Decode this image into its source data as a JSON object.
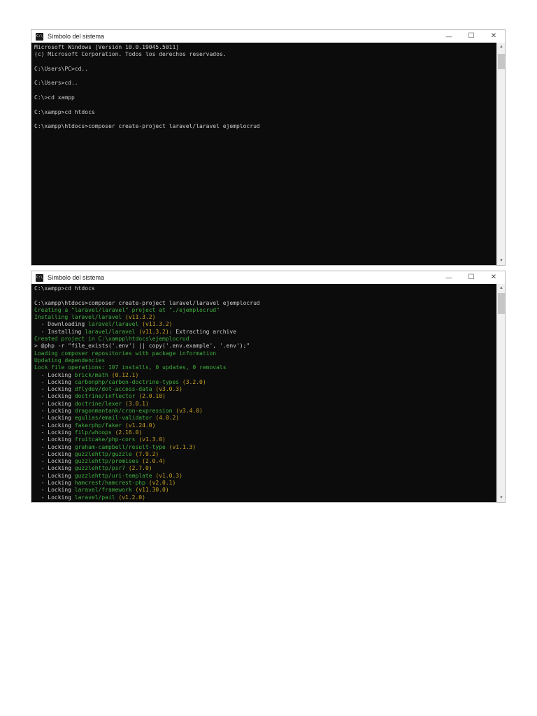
{
  "colors": {
    "d": "#cccccc",
    "g": "#3fae3f",
    "y": "#c9a227"
  },
  "chrome": {
    "cmd_icon_text": "C:\\",
    "minimize_glyph": "—",
    "maximize_glyph": "☐",
    "close_glyph": "✕",
    "scroll_up_glyph": "▲",
    "scroll_down_glyph": "▼"
  },
  "window1": {
    "title": "Símbolo del sistema",
    "lines": [
      [
        [
          "d",
          "Microsoft Windows [Versión 10.0.19045.5011]"
        ]
      ],
      [
        [
          "d",
          "(c) Microsoft Corporation. Todos los derechos reservados."
        ]
      ],
      [],
      [
        [
          "d",
          "C:\\Users\\PC>cd.."
        ]
      ],
      [],
      [
        [
          "d",
          "C:\\Users>cd.."
        ]
      ],
      [],
      [
        [
          "d",
          "C:\\>cd xampp"
        ]
      ],
      [],
      [
        [
          "d",
          "C:\\xampp>cd htdocs"
        ]
      ],
      [],
      [
        [
          "d",
          "C:\\xampp\\htdocs>composer create-project laravel/laravel ejemplocrud"
        ]
      ]
    ]
  },
  "window2": {
    "title": "Símbolo del sistema",
    "lines": [
      [
        [
          "d",
          "C:\\xampp>cd htdocs"
        ]
      ],
      [],
      [
        [
          "d",
          "C:\\xampp\\htdocs>composer create-project laravel/laravel ejemplocrud"
        ]
      ],
      [
        [
          "g",
          "Creating a \"laravel/laravel\" project at \"./ejemplocrud\""
        ]
      ],
      [
        [
          "g",
          "Installing laravel/laravel "
        ],
        [
          "y",
          "(v11.3.2)"
        ]
      ],
      [
        [
          "d",
          "  - Downloading "
        ],
        [
          "g",
          "laravel/laravel"
        ],
        [
          "y",
          " (v11.3.2)"
        ]
      ],
      [
        [
          "d",
          "  - Installing "
        ],
        [
          "g",
          "laravel/laravel"
        ],
        [
          "y",
          " (v11.3.2)"
        ],
        [
          "d",
          ": Extracting archive"
        ]
      ],
      [
        [
          "g",
          "Created project in C:\\xampp\\htdocs\\ejemplocrud"
        ]
      ],
      [
        [
          "d",
          "> @php -r \"file_exists('.env') || copy('.env.example', '.env');\""
        ]
      ],
      [
        [
          "g",
          "Loading composer repositories with package information"
        ]
      ],
      [
        [
          "g",
          "Updating dependencies"
        ]
      ],
      [
        [
          "g",
          "Lock file operations: 107 installs, 0 updates, 0 removals"
        ]
      ],
      [
        [
          "d",
          "  - Locking "
        ],
        [
          "g",
          "brick/math"
        ],
        [
          "y",
          " (0.12.1)"
        ]
      ],
      [
        [
          "d",
          "  - Locking "
        ],
        [
          "g",
          "carbonphp/carbon-doctrine-types"
        ],
        [
          "y",
          " (3.2.0)"
        ]
      ],
      [
        [
          "d",
          "  - Locking "
        ],
        [
          "g",
          "dflydev/dot-access-data"
        ],
        [
          "y",
          " (v3.0.3)"
        ]
      ],
      [
        [
          "d",
          "  - Locking "
        ],
        [
          "g",
          "doctrine/inflector"
        ],
        [
          "y",
          " (2.0.10)"
        ]
      ],
      [
        [
          "d",
          "  - Locking "
        ],
        [
          "g",
          "doctrine/lexer"
        ],
        [
          "y",
          " (3.0.1)"
        ]
      ],
      [
        [
          "d",
          "  - Locking "
        ],
        [
          "g",
          "dragonmantank/cron-expression"
        ],
        [
          "y",
          " (v3.4.0)"
        ]
      ],
      [
        [
          "d",
          "  - Locking "
        ],
        [
          "g",
          "egulias/email-validator"
        ],
        [
          "y",
          " (4.0.2)"
        ]
      ],
      [
        [
          "d",
          "  - Locking "
        ],
        [
          "g",
          "fakerphp/faker"
        ],
        [
          "y",
          " (v1.24.0)"
        ]
      ],
      [
        [
          "d",
          "  - Locking "
        ],
        [
          "g",
          "filp/whoops"
        ],
        [
          "y",
          " (2.16.0)"
        ]
      ],
      [
        [
          "d",
          "  - Locking "
        ],
        [
          "g",
          "fruitcake/php-cors"
        ],
        [
          "y",
          " (v1.3.0)"
        ]
      ],
      [
        [
          "d",
          "  - Locking "
        ],
        [
          "g",
          "graham-campbell/result-type"
        ],
        [
          "y",
          " (v1.1.3)"
        ]
      ],
      [
        [
          "d",
          "  - Locking "
        ],
        [
          "g",
          "guzzlehttp/guzzle"
        ],
        [
          "y",
          " (7.9.2)"
        ]
      ],
      [
        [
          "d",
          "  - Locking "
        ],
        [
          "g",
          "guzzlehttp/promises"
        ],
        [
          "y",
          " (2.0.4)"
        ]
      ],
      [
        [
          "d",
          "  - Locking "
        ],
        [
          "g",
          "guzzlehttp/psr7"
        ],
        [
          "y",
          " (2.7.0)"
        ]
      ],
      [
        [
          "d",
          "  - Locking "
        ],
        [
          "g",
          "guzzlehttp/uri-template"
        ],
        [
          "y",
          " (v1.0.3)"
        ]
      ],
      [
        [
          "d",
          "  - Locking "
        ],
        [
          "g",
          "hamcrest/hamcrest-php"
        ],
        [
          "y",
          " (v2.0.1)"
        ]
      ],
      [
        [
          "d",
          "  - Locking "
        ],
        [
          "g",
          "laravel/framework"
        ],
        [
          "y",
          " (v11.30.0)"
        ]
      ],
      [
        [
          "d",
          "  - Locking "
        ],
        [
          "g",
          "laravel/pail"
        ],
        [
          "y",
          " (v1.2.0)"
        ]
      ]
    ]
  }
}
